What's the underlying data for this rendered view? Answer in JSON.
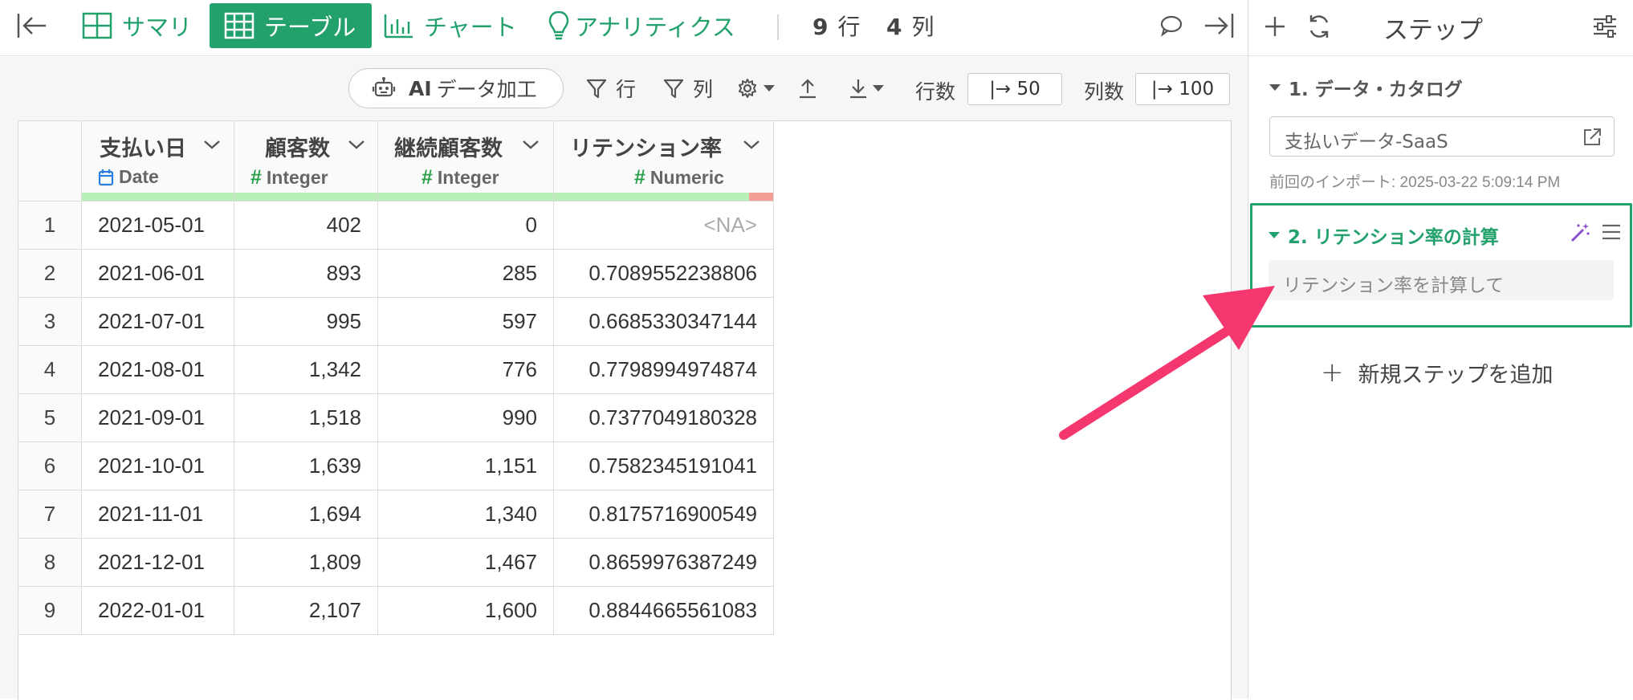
{
  "topbar": {
    "tabs": [
      {
        "label": "サマリ",
        "icon": "summary-grid-icon"
      },
      {
        "label": "テーブル",
        "icon": "table-icon",
        "active": true
      },
      {
        "label": "チャート",
        "icon": "bar-chart-icon"
      },
      {
        "label": "アナリティクス",
        "icon": "lightbulb-icon"
      }
    ],
    "rows": {
      "num": "9",
      "unit": "行"
    },
    "cols": {
      "num": "4",
      "unit": "列"
    }
  },
  "toolbar": {
    "ai_prefix": "AI",
    "ai_label": "データ加工",
    "filter_row": "行",
    "filter_col": "列",
    "rows_label": "行数",
    "rows_value": "|→ 50",
    "cols_label": "列数",
    "cols_value": "|→ 100"
  },
  "table": {
    "columns": [
      {
        "name": "支払い日",
        "type": "Date"
      },
      {
        "name": "顧客数",
        "type": "Integer"
      },
      {
        "name": "継続顧客数",
        "type": "Integer"
      },
      {
        "name": "リテンション率",
        "type": "Numeric"
      }
    ],
    "rows": [
      {
        "n": "1",
        "date": "2021-05-01",
        "customers": "402",
        "retained": "0",
        "rate": "<NA>"
      },
      {
        "n": "2",
        "date": "2021-06-01",
        "customers": "893",
        "retained": "285",
        "rate": "0.7089552238806"
      },
      {
        "n": "3",
        "date": "2021-07-01",
        "customers": "995",
        "retained": "597",
        "rate": "0.6685330347144"
      },
      {
        "n": "4",
        "date": "2021-08-01",
        "customers": "1,342",
        "retained": "776",
        "rate": "0.7798994974874"
      },
      {
        "n": "5",
        "date": "2021-09-01",
        "customers": "1,518",
        "retained": "990",
        "rate": "0.7377049180328"
      },
      {
        "n": "6",
        "date": "2021-10-01",
        "customers": "1,639",
        "retained": "1,151",
        "rate": "0.7582345191041"
      },
      {
        "n": "7",
        "date": "2021-11-01",
        "customers": "1,694",
        "retained": "1,340",
        "rate": "0.8175716900549"
      },
      {
        "n": "8",
        "date": "2021-12-01",
        "customers": "1,809",
        "retained": "1,467",
        "rate": "0.8659976387249"
      },
      {
        "n": "9",
        "date": "2022-01-01",
        "customers": "2,107",
        "retained": "1,600",
        "rate": "0.8844665561083"
      }
    ]
  },
  "steps_panel": {
    "title": "ステップ",
    "step1": {
      "title": "1. データ・カタログ",
      "source": "支払いデータ-SaaS",
      "last_import": "前回のインポート: 2025-03-22 5:09:14 PM"
    },
    "step2": {
      "title": "2. リテンション率の計算",
      "placeholder": "リテンション率を計算して"
    },
    "add_step": "新規ステップを追加"
  },
  "colors": {
    "accent": "#23a16c",
    "arrow": "#f4386f",
    "quality_ok": "#b7efb7",
    "quality_na": "#f29d96"
  }
}
